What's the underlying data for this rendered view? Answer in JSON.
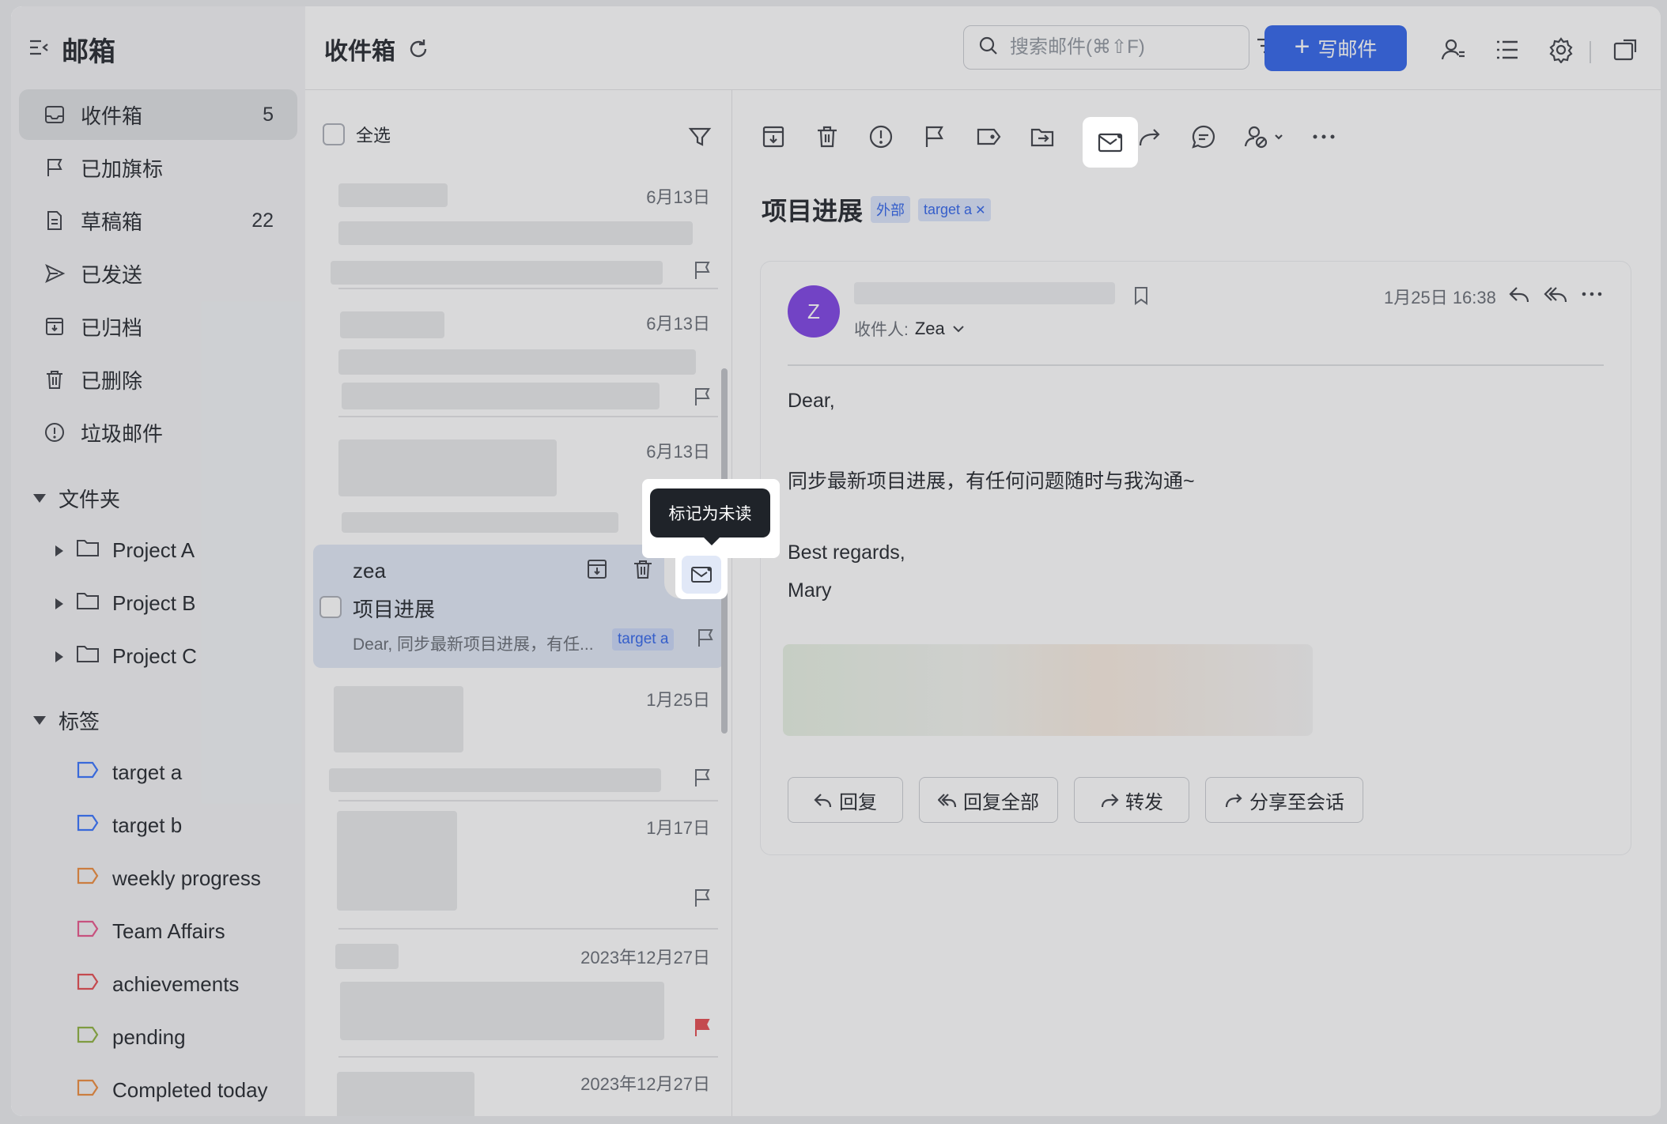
{
  "sidebar": {
    "title": "邮箱",
    "nav": [
      {
        "label": "收件箱",
        "count": "5",
        "icon": "inbox-icon"
      },
      {
        "label": "已加旗标",
        "count": "",
        "icon": "flag-icon"
      },
      {
        "label": "草稿箱",
        "count": "22",
        "icon": "draft-icon"
      },
      {
        "label": "已发送",
        "count": "",
        "icon": "send-icon"
      },
      {
        "label": "已归档",
        "count": "",
        "icon": "archive-icon"
      },
      {
        "label": "已删除",
        "count": "",
        "icon": "trash-icon"
      },
      {
        "label": "垃圾邮件",
        "count": "",
        "icon": "spam-icon"
      }
    ],
    "folders_title": "文件夹",
    "folders": [
      "Project A",
      "Project B",
      "Project C"
    ],
    "tags_title": "标签",
    "tags": [
      {
        "label": "target a",
        "color": "#3370ff"
      },
      {
        "label": "target b",
        "color": "#3370ff"
      },
      {
        "label": "weekly progress",
        "color": "#ed8a3a"
      },
      {
        "label": "Team Affairs",
        "color": "#e8528a"
      },
      {
        "label": "achievements",
        "color": "#e5484d"
      },
      {
        "label": "pending",
        "color": "#8cb03c"
      },
      {
        "label": "Completed today",
        "color": "#ed8a3a"
      }
    ]
  },
  "topbar": {
    "title": "收件箱",
    "search_placeholder": "搜索邮件(⌘⇧F)",
    "compose_label": "写邮件"
  },
  "list": {
    "select_all": "全选",
    "dates": [
      "6月13日",
      "6月13日",
      "6月13日",
      "1月25日",
      "1月17日",
      "2023年12月27日",
      "2023年12月27日"
    ],
    "selected": {
      "sender": "zea",
      "subject": "项目进展",
      "preview": "Dear, 同步最新项目进展，有任...",
      "tag": "target a"
    },
    "tooltip": "标记为未读"
  },
  "reader": {
    "title": "项目进展",
    "badge_external": "外部",
    "badge_tag": "target a",
    "avatar_letter": "Z",
    "recipient_label": "收件人:",
    "recipient_name": "Zea",
    "date": "1月25日 16:38",
    "body": [
      "Dear,",
      "同步最新项目进展，有任何问题随时与我沟通~",
      "Best regards,",
      "Mary"
    ],
    "actions": [
      "回复",
      "回复全部",
      "转发",
      "分享至会话"
    ]
  },
  "colors": {
    "accent": "#2d62eb",
    "flag_red": "#e5484d",
    "avatar": "#7b3fe4"
  }
}
